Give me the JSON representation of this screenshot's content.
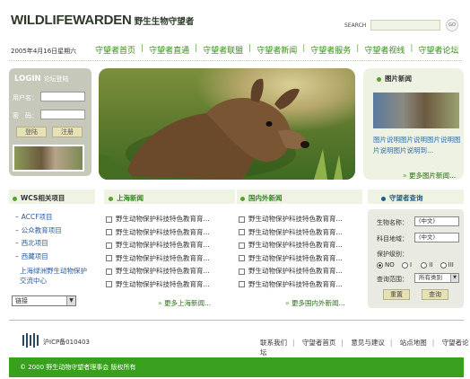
{
  "header": {
    "logo_en": "WILDLIFEWARDEN",
    "logo_cn": "野生生物守望者",
    "search_label": "SEARCH",
    "go": "GO"
  },
  "date": "2005年4月16日星期六",
  "nav": [
    "守望者首页",
    "守望者直通",
    "守望者联盟",
    "守望者新闻",
    "守望者服务",
    "守望者视线",
    "守望者论坛"
  ],
  "login": {
    "title": "LOGIN",
    "subtitle": "论坛登陆",
    "user_label": "用户名：",
    "pass_label": "密　码：",
    "login_btn": "登陆",
    "register_btn": "注册"
  },
  "pic_news": {
    "title": "图片新闻",
    "caption": "图片说明图片说明图片说明图片说明图片说明到...",
    "more": "更多图片新闻..."
  },
  "wcs": {
    "title": "WCS相关项目",
    "items": [
      "ACCF项目",
      "公众教育项目",
      "西北项目",
      "西藏项目"
    ],
    "partner": "上海绿洲野生动物保护交流中心",
    "select": "链接"
  },
  "shanghai": {
    "title": "上海新闻",
    "items": [
      "野生动物保护科技特色教育育...",
      "野生动物保护科技特色教育育...",
      "野生动物保护科技特色教育育...",
      "野生动物保护科技特色教育育...",
      "野生动物保护科技特色教育育...",
      "野生动物保护科技特色教育育..."
    ],
    "more": "更多上海新闻..."
  },
  "domestic": {
    "title": "国内外新闻",
    "items": [
      "野生动物保护科技特色教育育...",
      "野生动物保护科技特色教育育...",
      "野生动物保护科技特色教育育...",
      "野生动物保护科技特色教育育...",
      "野生动物保护科技特色教育育...",
      "野生动物保护科技特色教育育..."
    ],
    "more": "更多国内外新闻..."
  },
  "query": {
    "title": "守望者查询",
    "name_label": "生物名称：",
    "name_value": "(中文)",
    "family_label": "科目地域：",
    "family_value": "(中文)",
    "level_label": "保护级别：",
    "levels": [
      "NO",
      "I",
      "II",
      "III"
    ],
    "range_label": "查询范围：",
    "range_value": "所有类别",
    "reset": "重置",
    "search": "查询"
  },
  "footer": {
    "icp": "沪ICP备010403",
    "links": [
      "联系我们",
      "守望者首页",
      "意见与建议",
      "站点地图",
      "守望者论坛"
    ],
    "copyright": "© 2000 野生动物守望者理事会 版权所有"
  },
  "colors": {
    "accent": "#38a01c",
    "nav": "#3a8a1a",
    "link": "#2a5aa0"
  }
}
